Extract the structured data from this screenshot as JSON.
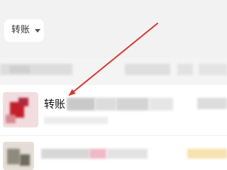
{
  "filter": {
    "chip_label": "转账",
    "chip_icon": "caret-down-icon"
  },
  "rows": [
    {
      "title": "转账",
      "avatar": "blurred-avatar"
    },
    {
      "avatar": "blurred-avatar"
    }
  ],
  "colors": {
    "background": "#f2f2f2",
    "chip_background": "#ffffff",
    "annotation_arrow": "#e0332b",
    "avatar_accent": "#c41e2b"
  },
  "annotation": {
    "type": "arrow",
    "color": "#e0332b"
  }
}
